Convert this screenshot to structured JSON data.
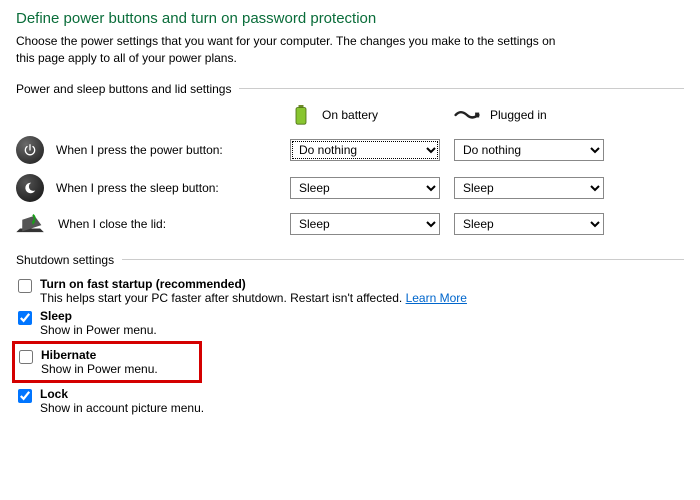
{
  "page": {
    "title": "Define power buttons and turn on password protection",
    "description": "Choose the power settings that you want for your computer. The changes you make to the settings on this page apply to all of your power plans."
  },
  "section1": {
    "title": "Power and sleep buttons and lid settings",
    "col_battery": "On battery",
    "col_plugged": "Plugged in",
    "rows": {
      "power": {
        "label": "When I press the power button:",
        "battery": "Do nothing",
        "plugged": "Do nothing"
      },
      "sleep": {
        "label": "When I press the sleep button:",
        "battery": "Sleep",
        "plugged": "Sleep"
      },
      "lid": {
        "label": "When I close the lid:",
        "battery": "Sleep",
        "plugged": "Sleep"
      }
    }
  },
  "section2": {
    "title": "Shutdown settings",
    "fast_startup": {
      "label": "Turn on fast startup (recommended)",
      "desc_prefix": "This helps start your PC faster after shutdown. Restart isn't affected. ",
      "learn_more": "Learn More",
      "checked": false
    },
    "sleep": {
      "label": "Sleep",
      "desc": "Show in Power menu.",
      "checked": true
    },
    "hibernate": {
      "label": "Hibernate",
      "desc": "Show in Power menu.",
      "checked": false
    },
    "lock": {
      "label": "Lock",
      "desc": "Show in account picture menu.",
      "checked": true
    }
  },
  "select_options": {
    "do_nothing": "Do nothing",
    "sleep": "Sleep"
  }
}
